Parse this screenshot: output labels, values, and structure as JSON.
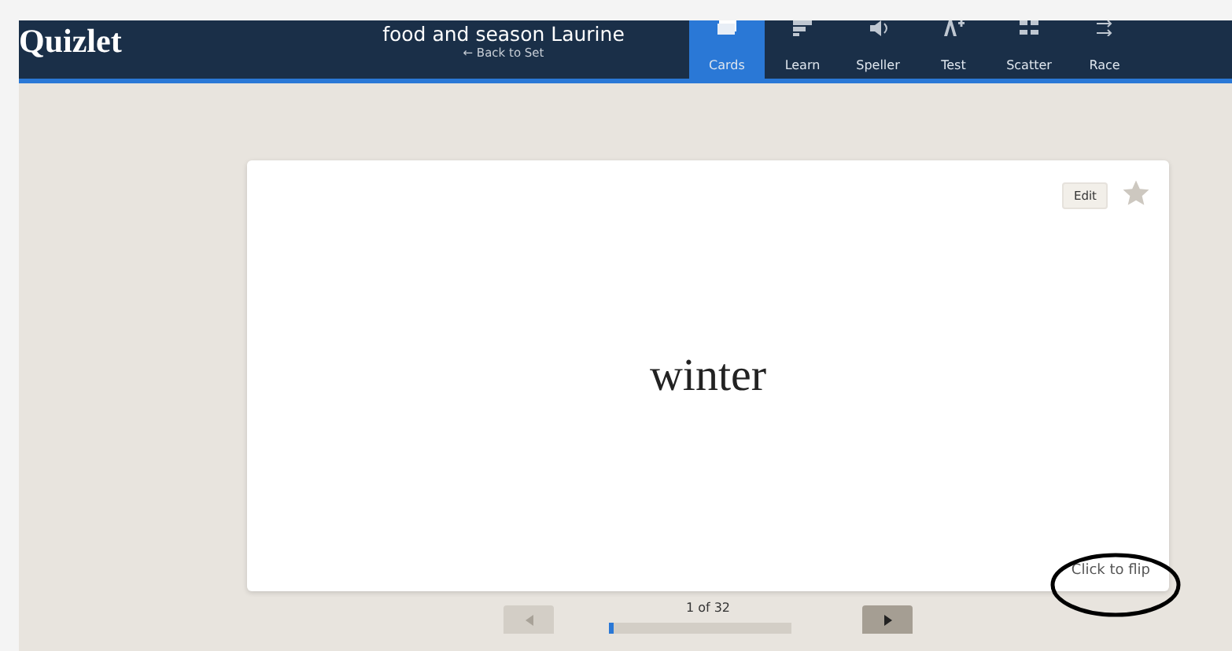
{
  "header": {
    "logo": "Quizlet",
    "set_title": "food and season Laurine",
    "back_link": "← Back to Set"
  },
  "modes": [
    {
      "label": "Cards",
      "kind": "cards",
      "selected": true
    },
    {
      "label": "Learn",
      "kind": "learn",
      "selected": false
    },
    {
      "label": "Speller",
      "kind": "speller",
      "selected": false
    },
    {
      "label": "Test",
      "kind": "test",
      "selected": false
    },
    {
      "label": "Scatter",
      "kind": "scatter",
      "selected": false
    },
    {
      "label": "Race",
      "kind": "race",
      "selected": false
    }
  ],
  "card": {
    "term": "winter",
    "edit_button": "Edit",
    "starred": false,
    "hint": "Click to flip"
  },
  "navigation": {
    "counter": "1 of 32",
    "level": 0.03,
    "previous_disabled": true,
    "next_disabled": false
  }
}
